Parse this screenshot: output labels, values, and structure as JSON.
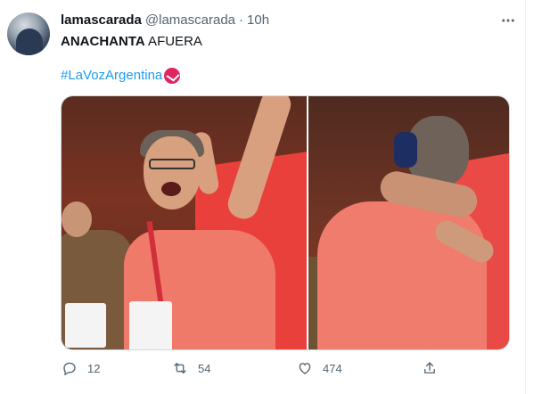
{
  "tweet": {
    "display_name": "lamascarada",
    "handle": "@lamascarada",
    "separator": "·",
    "time": "10h",
    "text_bold": "ANACHANTA",
    "text_rest": " AFUERA",
    "hashtag": "#LaVozArgentina",
    "hashflag_icon": "la-voz-hashflag-icon",
    "media_count": 2
  },
  "actions": {
    "reply_count": "12",
    "retweet_count": "54",
    "like_count": "474"
  },
  "colors": {
    "link": "#1d9bf0",
    "secondary_text": "#536471",
    "hashflag": "#e0245e"
  }
}
